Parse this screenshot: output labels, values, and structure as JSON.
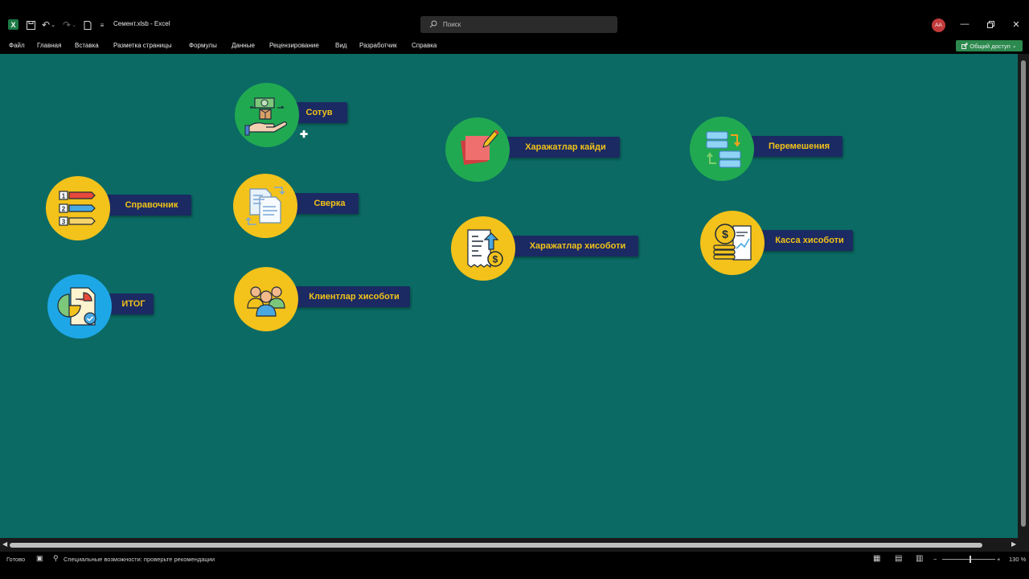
{
  "window": {
    "title": "Семент.xlsb  -  Excel",
    "search_placeholder": "Поиск",
    "avatar_initials": "АА"
  },
  "menu": {
    "items": [
      "Файл",
      "Главная",
      "Вставка",
      "Разметка страницы",
      "Формулы",
      "Данные",
      "Рецензирование",
      "Вид",
      "Разработчик",
      "Справка"
    ],
    "share_label": "Общий доступ"
  },
  "buttons": {
    "sotuv": "Сотув",
    "spravochnik": "Справочник",
    "sverka": "Сверка",
    "itog": "ИТОГ",
    "klientlar": "Клиентлар хисоботи",
    "kharajatlar_kaydi": "Харажатлар кайди",
    "kharajatlar_hisoboti": "Харажатлар хисоботи",
    "peremesheniya": "Перемешения",
    "kassa": "Касса хисоботи"
  },
  "status": {
    "ready": "Готово",
    "accessibility": "Специальные возможности: проверьте рекомендации",
    "zoom": "130 %"
  },
  "colors": {
    "sheet_bg": "#0b6a64",
    "label_bg": "#1b2a63",
    "label_text": "#f2c318",
    "circle_green": "#21a952",
    "circle_yellow": "#f3c21b",
    "circle_blue": "#1ea7e6"
  }
}
